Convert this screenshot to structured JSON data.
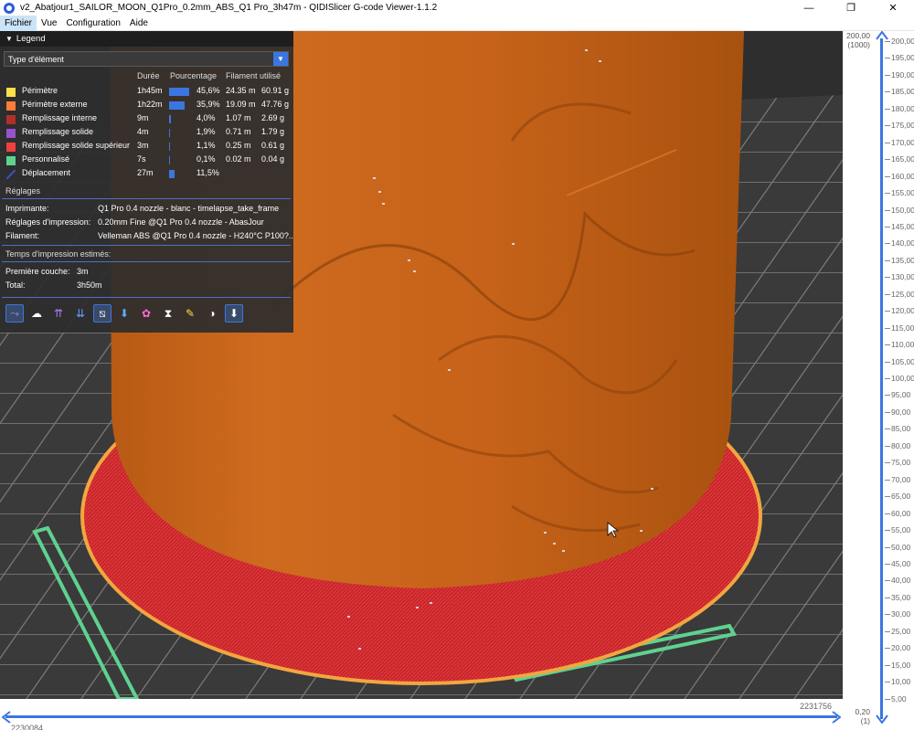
{
  "window": {
    "title": "v2_Abatjour1_SAILOR_MOON_Q1Pro_0.2mm_ABS_Q1 Pro_3h47m - QIDISlicer G-code Viewer-1.1.2",
    "minimize": "—",
    "maximize": "❐",
    "close": "✕"
  },
  "menu": {
    "file": "Fichier",
    "view": "Vue",
    "config": "Configuration",
    "help": "Aide"
  },
  "legend": {
    "title": "Legend",
    "view_type": "Type d'élément",
    "columns": {
      "time": "Durée",
      "percent": "Pourcentage",
      "filament": "Filament utilisé"
    },
    "features": [
      {
        "name": "Périmètre",
        "color": "#ffe04a",
        "time": "1h45m",
        "percent": "45,6%",
        "pct": 45.6,
        "length": "24.35 m",
        "weight": "60.91 g"
      },
      {
        "name": "Périmètre externe",
        "color": "#ff7d38",
        "time": "1h22m",
        "percent": "35,9%",
        "pct": 35.9,
        "length": "19.09 m",
        "weight": "47.76 g"
      },
      {
        "name": "Remplissage interne",
        "color": "#b03029",
        "time": "9m",
        "percent": "4,0%",
        "pct": 4.0,
        "length": "1.07 m",
        "weight": "2.69 g"
      },
      {
        "name": "Remplissage solide",
        "color": "#9654cc",
        "time": "4m",
        "percent": "1,9%",
        "pct": 1.9,
        "length": "0.71 m",
        "weight": "1.79 g"
      },
      {
        "name": "Remplissage solide supérieur",
        "color": "#f04040",
        "time": "3m",
        "percent": "1,1%",
        "pct": 1.1,
        "length": "0.25 m",
        "weight": "0.61 g"
      },
      {
        "name": "Personnalisé",
        "color": "#5ed28f",
        "time": "7s",
        "percent": "0,1%",
        "pct": 0.1,
        "length": "0.02 m",
        "weight": "0.04 g"
      },
      {
        "name": "Déplacement",
        "color": "#3c50c8",
        "time": "27m",
        "percent": "11,5%",
        "pct": 11.5,
        "length": "",
        "weight": ""
      }
    ],
    "settings_title": "Réglages",
    "printer_label": "Imprimante:",
    "printer_value": "Q1 Pro 0.4 nozzle - blanc - timelapse_take_frame",
    "print_label": "Réglages d'impression:",
    "print_value": "0.20mm Fine @Q1 Pro 0.4 nozzle - AbasJour",
    "filament_label": "Filament:",
    "filament_value": "Velleman ABS @Q1 Pro 0.4 nozzle - H240°C P100?..",
    "time_title": "Temps d'impression estimés:",
    "first_layer_label": "Première couche:",
    "first_layer_value": "3m",
    "total_label": "Total:",
    "total_value": "3h50m"
  },
  "vertical_slider": {
    "top_value": "200,00",
    "top_layer": "(1000)",
    "bottom_value": "0,20",
    "bottom_layer": "(1)",
    "ticks": [
      "200,00",
      "195,00",
      "190,00",
      "185,00",
      "180,00",
      "175,00",
      "170,00",
      "165,00",
      "160,00",
      "155,00",
      "150,00",
      "145,00",
      "140,00",
      "135,00",
      "130,00",
      "125,00",
      "120,00",
      "115,00",
      "110,00",
      "105,00",
      "100,00",
      "95,00",
      "90,00",
      "85,00",
      "80,00",
      "75,00",
      "70,00",
      "65,00",
      "60,00",
      "55,00",
      "50,00",
      "45,00",
      "40,00",
      "35,00",
      "30,00",
      "25,00",
      "20,00",
      "15,00",
      "10,00",
      "5,00"
    ]
  },
  "horizontal_slider": {
    "right_value": "2231756",
    "left_value": "2230084"
  }
}
